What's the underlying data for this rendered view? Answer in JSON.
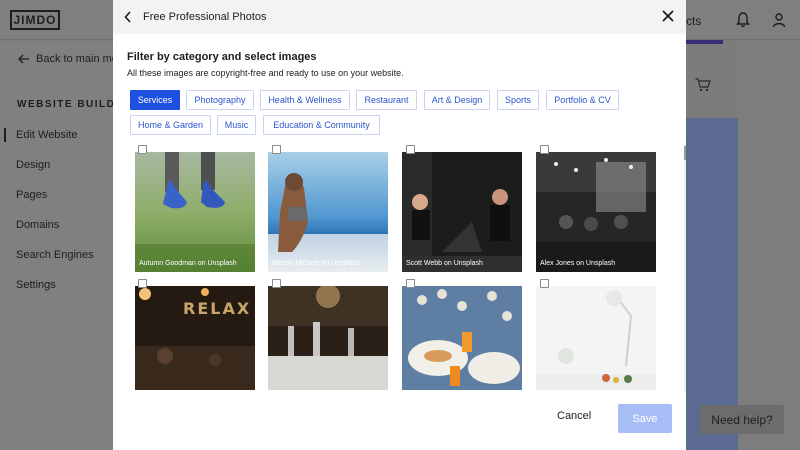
{
  "app": {
    "logo": "JIMDO",
    "header_right_text": "cts",
    "icons": {
      "bell": "bell-icon",
      "user": "user-icon",
      "cart": "cart-icon"
    }
  },
  "sidebar": {
    "back_label": "Back to main me",
    "section_label": "WEBSITE BUILDER",
    "items": [
      {
        "label": "Edit Website",
        "active": true
      },
      {
        "label": "Design"
      },
      {
        "label": "Pages"
      },
      {
        "label": "Domains"
      },
      {
        "label": "Search Engines"
      },
      {
        "label": "Settings"
      }
    ]
  },
  "modal": {
    "title": "Free Professional Photos",
    "filter_title": "Filter by category and select images",
    "filter_subtitle": "All these images are copyright-free and ready to use on your website.",
    "categories": [
      {
        "label": "Services",
        "active": true
      },
      {
        "label": "Photography"
      },
      {
        "label": "Health & Wellness"
      },
      {
        "label": "Restaurant"
      },
      {
        "label": "Art & Design"
      },
      {
        "label": "Sports"
      },
      {
        "label": "Portfolio & CV"
      },
      {
        "label": "Home & Garden"
      },
      {
        "label": "Music"
      },
      {
        "label": "Education & Community"
      }
    ],
    "photos": [
      {
        "credit": "Autumn Goodman on Unsplash",
        "checked": false
      },
      {
        "credit": "Marion Michele on Unsplash",
        "checked": false
      },
      {
        "credit": "Scott Webb on Unsplash",
        "checked": false
      },
      {
        "credit": "Alex Jones on Unsplash",
        "checked": false
      },
      {
        "credit": "",
        "checked": false
      },
      {
        "credit": "",
        "checked": false
      },
      {
        "credit": "",
        "checked": false
      },
      {
        "credit": "",
        "checked": false
      }
    ],
    "cancel_label": "Cancel",
    "save_label": "Save"
  },
  "help_label": "Need help?",
  "colors": {
    "accent": "#1d4fe0",
    "save_disabled": "#a7bdf5",
    "overlay": "#7f7f7f"
  }
}
